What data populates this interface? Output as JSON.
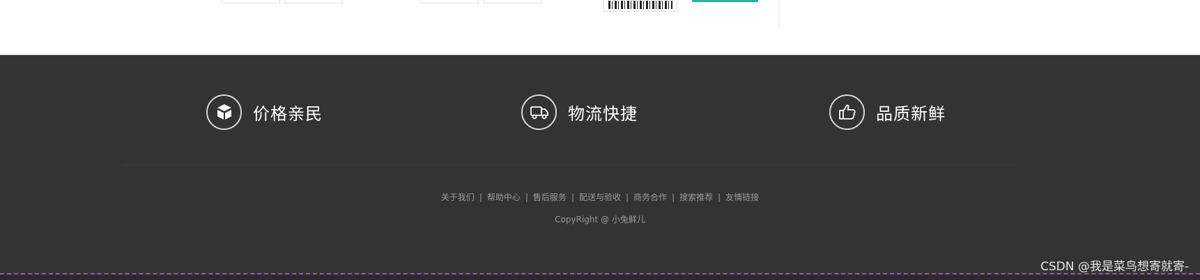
{
  "features": [
    {
      "icon": "price-box-icon",
      "label": "价格亲民"
    },
    {
      "icon": "delivery-truck-icon",
      "label": "物流快捷"
    },
    {
      "icon": "thumbs-up-icon",
      "label": "品质新鲜"
    }
  ],
  "footer_links": [
    "关于我们",
    "帮助中心",
    "售后服务",
    "配送与验收",
    "商务合作",
    "搜索推荐",
    "友情链接"
  ],
  "link_separator": "|",
  "copyright": "CopyRight @ 小兔鲜儿",
  "watermark": "CSDN @我是菜鸟想寄就寄-",
  "colors": {
    "footer_bg": "#333333",
    "accent_teal": "#28b29c",
    "link_text": "#9a9a9a",
    "dashed_border": "#b23ce0"
  }
}
